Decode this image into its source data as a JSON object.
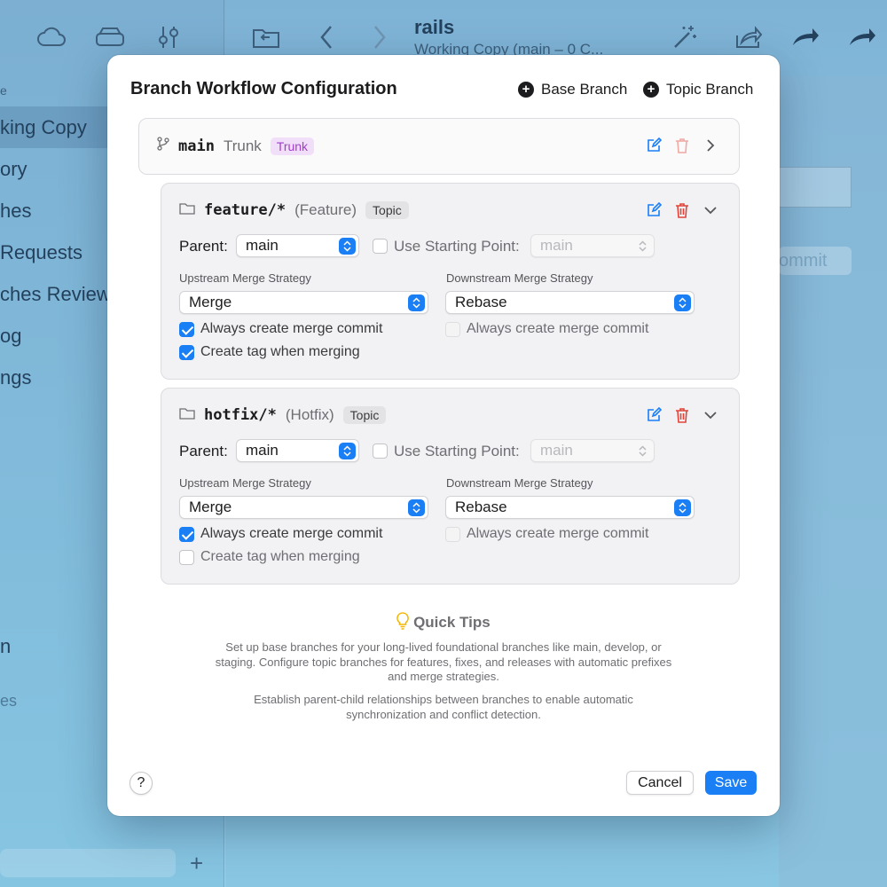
{
  "background": {
    "sidebar": {
      "section_label": "e",
      "items": [
        "king Copy",
        "ory",
        "hes",
        "Requests",
        "ches Review",
        "og",
        "ngs"
      ],
      "extra_item": "n",
      "extra_dim": "es"
    },
    "window_title": "rails",
    "window_subtitle": "Working Copy (main – 0 C...",
    "commit_button": "ommit"
  },
  "dialog": {
    "title": "Branch Workflow Configuration",
    "add_base_branch": "Base Branch",
    "add_topic_branch": "Topic Branch",
    "trunk": {
      "name": "main",
      "role": "Trunk",
      "badge": "Trunk"
    },
    "topics": [
      {
        "prefix": "feature/*",
        "type": "(Feature)",
        "badge": "Topic",
        "parent_label": "Parent:",
        "parent_value": "main",
        "use_starting_point_label": "Use Starting Point:",
        "starting_point_value": "main",
        "upstream_label": "Upstream Merge Strategy",
        "upstream_value": "Merge",
        "downstream_label": "Downstream Merge Strategy",
        "downstream_value": "Rebase",
        "upstream_always_merge_commit_label": "Always create merge commit",
        "upstream_always_merge_commit": true,
        "create_tag_label": "Create tag when merging",
        "create_tag": true,
        "downstream_always_merge_commit_label": "Always create merge commit",
        "downstream_always_merge_commit": false
      },
      {
        "prefix": "hotfix/*",
        "type": "(Hotfix)",
        "badge": "Topic",
        "parent_label": "Parent:",
        "parent_value": "main",
        "use_starting_point_label": "Use Starting Point:",
        "starting_point_value": "main",
        "upstream_label": "Upstream Merge Strategy",
        "upstream_value": "Merge",
        "downstream_label": "Downstream Merge Strategy",
        "downstream_value": "Rebase",
        "upstream_always_merge_commit_label": "Always create merge commit",
        "upstream_always_merge_commit": true,
        "create_tag_label": "Create tag when merging",
        "create_tag": false,
        "downstream_always_merge_commit_label": "Always create merge commit",
        "downstream_always_merge_commit": false
      }
    ],
    "tips": {
      "title": "Quick Tips",
      "paragraph1": "Set up base branches for your long-lived foundational branches like main, develop, or staging. Configure topic branches for features, fixes, and releases with automatic prefixes and merge strategies.",
      "paragraph2": "Establish parent-child relationships between branches to enable automatic synchronization and conflict detection."
    },
    "help_label": "?",
    "cancel_label": "Cancel",
    "save_label": "Save"
  },
  "colors": {
    "accent": "#1a7ef5",
    "delete": "#e0443a",
    "trunk_badge": "#a040c8"
  }
}
